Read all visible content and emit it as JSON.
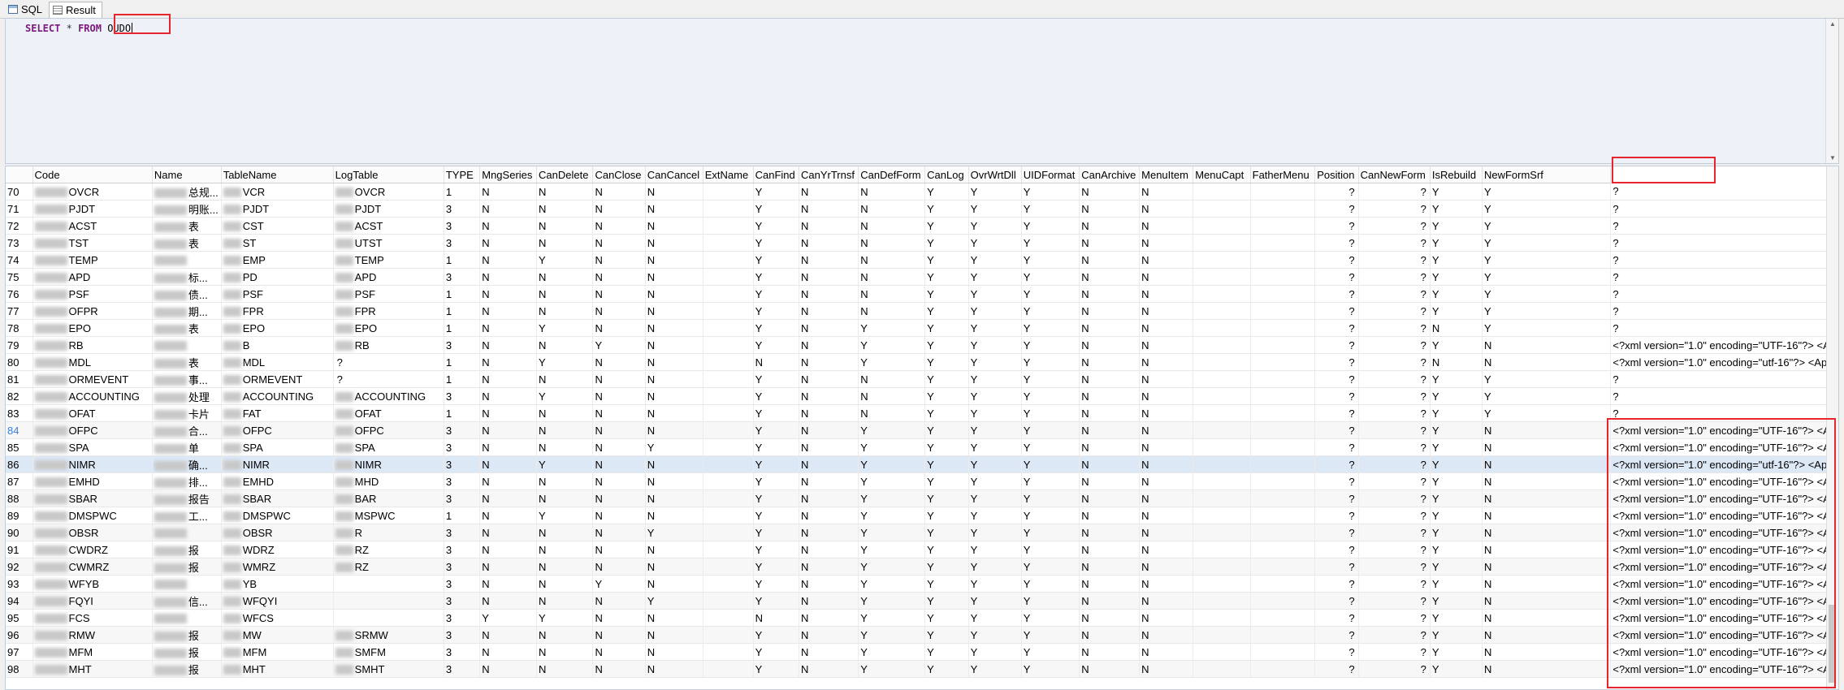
{
  "tabs": [
    {
      "label": "SQL"
    },
    {
      "label": "Result"
    }
  ],
  "query": {
    "select": "SELECT",
    "star": "*",
    "from": "FROM",
    "table": "OUDO"
  },
  "columns": [
    "Code",
    "Name",
    "TableName",
    "LogTable",
    "TYPE",
    "MngSeries",
    "CanDelete",
    "CanClose",
    "CanCancel",
    "ExtName",
    "CanFind",
    "CanYrTrnsf",
    "CanDefForm",
    "CanLog",
    "OvrWrtDll",
    "UIDFormat",
    "CanArchive",
    "MenuItem",
    "MenuCapt",
    "FatherMenu",
    "Position",
    "CanNewForm",
    "IsRebuild",
    "NewFormSrf"
  ],
  "rows": [
    {
      "n": "70",
      "code": "OVCR",
      "name": "总规...",
      "table": "VCR",
      "log": "OVCR",
      "type": "1",
      "v": [
        "N",
        "N",
        "N",
        "N",
        "",
        "Y",
        "N",
        "N",
        "Y",
        "Y",
        "Y",
        "N",
        "N",
        "",
        "",
        "?",
        "?",
        "Y",
        "Y"
      ],
      "srf": "?"
    },
    {
      "n": "71",
      "code": "PJDT",
      "name": "明账...",
      "table": "PJDT",
      "log": "PJDT",
      "type": "3",
      "v": [
        "N",
        "N",
        "N",
        "N",
        "",
        "Y",
        "N",
        "N",
        "Y",
        "Y",
        "Y",
        "N",
        "N",
        "",
        "",
        "?",
        "?",
        "Y",
        "Y"
      ],
      "srf": "?"
    },
    {
      "n": "72",
      "code": "ACST",
      "name": "表",
      "table": "CST",
      "log": "ACST",
      "type": "3",
      "v": [
        "N",
        "N",
        "N",
        "N",
        "",
        "Y",
        "N",
        "N",
        "Y",
        "Y",
        "Y",
        "N",
        "N",
        "",
        "",
        "?",
        "?",
        "Y",
        "Y"
      ],
      "srf": "?"
    },
    {
      "n": "73",
      "code": "TST",
      "name": "表",
      "table": "ST",
      "log": "UTST",
      "type": "3",
      "v": [
        "N",
        "N",
        "N",
        "N",
        "",
        "Y",
        "N",
        "N",
        "Y",
        "Y",
        "Y",
        "N",
        "N",
        "",
        "",
        "?",
        "?",
        "Y",
        "Y"
      ],
      "srf": "?"
    },
    {
      "n": "74",
      "code": "TEMP",
      "name": "",
      "table": "EMP",
      "log": "TEMP",
      "type": "1",
      "v": [
        "N",
        "Y",
        "N",
        "N",
        "",
        "Y",
        "N",
        "N",
        "Y",
        "Y",
        "Y",
        "N",
        "N",
        "",
        "",
        "?",
        "?",
        "Y",
        "Y"
      ],
      "srf": "?"
    },
    {
      "n": "75",
      "code": "APD",
      "name": "标...",
      "table": "PD",
      "log": "APD",
      "type": "3",
      "v": [
        "N",
        "N",
        "N",
        "N",
        "",
        "Y",
        "N",
        "N",
        "Y",
        "Y",
        "Y",
        "N",
        "N",
        "",
        "",
        "?",
        "?",
        "Y",
        "Y"
      ],
      "srf": "?"
    },
    {
      "n": "76",
      "code": "PSF",
      "name": "债...",
      "table": "PSF",
      "log": "PSF",
      "type": "1",
      "v": [
        "N",
        "N",
        "N",
        "N",
        "",
        "Y",
        "N",
        "N",
        "Y",
        "Y",
        "Y",
        "N",
        "N",
        "",
        "",
        "?",
        "?",
        "Y",
        "Y"
      ],
      "srf": "?"
    },
    {
      "n": "77",
      "code": "OFPR",
      "name": "期...",
      "table": "FPR",
      "log": "FPR",
      "type": "1",
      "v": [
        "N",
        "N",
        "N",
        "N",
        "",
        "Y",
        "N",
        "N",
        "Y",
        "Y",
        "Y",
        "N",
        "N",
        "",
        "",
        "?",
        "?",
        "Y",
        "Y"
      ],
      "srf": "?"
    },
    {
      "n": "78",
      "code": "EPO",
      "name": "表",
      "table": "EPO",
      "log": "EPO",
      "type": "1",
      "v": [
        "N",
        "Y",
        "N",
        "N",
        "",
        "Y",
        "N",
        "Y",
        "Y",
        "Y",
        "Y",
        "N",
        "N",
        "",
        "",
        "?",
        "?",
        "N",
        "Y"
      ],
      "srf": "?"
    },
    {
      "n": "79",
      "code": "RB",
      "name": "",
      "table": "B",
      "log": "RB",
      "type": "3",
      "v": [
        "N",
        "N",
        "Y",
        "N",
        "",
        "Y",
        "N",
        "Y",
        "Y",
        "Y",
        "Y",
        "N",
        "N",
        "",
        "",
        "?",
        "?",
        "Y",
        "N"
      ],
      "srf": "<?xml version=\"1.0\" encoding=\"UTF-16\"?> <Ap"
    },
    {
      "n": "80",
      "code": "MDL",
      "name": "表",
      "table": "MDL",
      "log": "?",
      "type": "1",
      "v": [
        "N",
        "Y",
        "N",
        "N",
        "",
        "N",
        "N",
        "Y",
        "Y",
        "Y",
        "Y",
        "N",
        "N",
        "",
        "",
        "?",
        "?",
        "N",
        "N"
      ],
      "srf": "<?xml version=\"1.0\" encoding=\"utf-16\"?> <Ap"
    },
    {
      "n": "81",
      "code": "ORMEVENT",
      "name": "事...",
      "table": "ORMEVENT",
      "log": "?",
      "type": "1",
      "v": [
        "N",
        "N",
        "N",
        "N",
        "",
        "Y",
        "N",
        "N",
        "Y",
        "Y",
        "Y",
        "N",
        "N",
        "",
        "",
        "?",
        "?",
        "Y",
        "Y"
      ],
      "srf": "?"
    },
    {
      "n": "82",
      "code": "ACCOUNTING",
      "name": "处理",
      "table": "ACCOUNTING",
      "log": "ACCOUNTING",
      "type": "3",
      "v": [
        "N",
        "Y",
        "N",
        "N",
        "",
        "Y",
        "N",
        "N",
        "Y",
        "Y",
        "Y",
        "N",
        "N",
        "",
        "",
        "?",
        "?",
        "Y",
        "Y"
      ],
      "srf": "?"
    },
    {
      "n": "83",
      "code": "OFAT",
      "name": "卡片",
      "table": "FAT",
      "log": "OFAT",
      "type": "1",
      "v": [
        "N",
        "N",
        "N",
        "N",
        "",
        "Y",
        "N",
        "N",
        "Y",
        "Y",
        "Y",
        "N",
        "N",
        "",
        "",
        "?",
        "?",
        "Y",
        "Y"
      ],
      "srf": "?"
    },
    {
      "n": "84",
      "code": "OFPC",
      "name": "合...",
      "table": "OFPC",
      "log": "OFPC",
      "type": "3",
      "v": [
        "N",
        "N",
        "N",
        "N",
        "",
        "Y",
        "N",
        "Y",
        "Y",
        "Y",
        "Y",
        "N",
        "N",
        "",
        "",
        "?",
        "?",
        "Y",
        "N"
      ],
      "srf": "<?xml version=\"1.0\" encoding=\"UTF-16\"?> <A"
    },
    {
      "n": "85",
      "code": "SPA",
      "name": "单",
      "table": "SPA",
      "log": "SPA",
      "type": "3",
      "v": [
        "N",
        "N",
        "N",
        "Y",
        "",
        "Y",
        "N",
        "Y",
        "Y",
        "Y",
        "Y",
        "N",
        "N",
        "",
        "",
        "?",
        "?",
        "Y",
        "N"
      ],
      "srf": "<?xml version=\"1.0\" encoding=\"UTF-16\"?> <A"
    },
    {
      "n": "86",
      "code": "NIMR",
      "name": "确...",
      "table": "NIMR",
      "log": "NIMR",
      "type": "3",
      "v": [
        "N",
        "Y",
        "N",
        "N",
        "",
        "Y",
        "N",
        "Y",
        "Y",
        "Y",
        "Y",
        "N",
        "N",
        "",
        "",
        "?",
        "?",
        "Y",
        "N"
      ],
      "srf": "<?xml version=\"1.0\" encoding=\"utf-16\"?> <Ap"
    },
    {
      "n": "87",
      "code": "EMHD",
      "name": "排...",
      "table": "EMHD",
      "log": "MHD",
      "type": "3",
      "v": [
        "N",
        "N",
        "N",
        "N",
        "",
        "Y",
        "N",
        "Y",
        "Y",
        "Y",
        "Y",
        "N",
        "N",
        "",
        "",
        "?",
        "?",
        "Y",
        "N"
      ],
      "srf": "<?xml version=\"1.0\" encoding=\"UTF-16\"?> <A"
    },
    {
      "n": "88",
      "code": "SBAR",
      "name": "报告",
      "table": "SBAR",
      "log": "BAR",
      "type": "3",
      "v": [
        "N",
        "N",
        "N",
        "N",
        "",
        "Y",
        "N",
        "Y",
        "Y",
        "Y",
        "Y",
        "N",
        "N",
        "",
        "",
        "?",
        "?",
        "Y",
        "N"
      ],
      "srf": "<?xml version=\"1.0\" encoding=\"UTF-16\"?> <A"
    },
    {
      "n": "89",
      "code": "DMSPWC",
      "name": "工...",
      "table": "DMSPWC",
      "log": "MSPWC",
      "type": "1",
      "v": [
        "N",
        "Y",
        "N",
        "N",
        "",
        "Y",
        "N",
        "Y",
        "Y",
        "Y",
        "Y",
        "N",
        "N",
        "",
        "",
        "?",
        "?",
        "Y",
        "N"
      ],
      "srf": "<?xml version=\"1.0\" encoding=\"UTF-16\"?> <A"
    },
    {
      "n": "90",
      "code": "OBSR",
      "name": "",
      "table": "OBSR",
      "log": "R",
      "type": "3",
      "v": [
        "N",
        "N",
        "N",
        "Y",
        "",
        "Y",
        "N",
        "Y",
        "Y",
        "Y",
        "Y",
        "N",
        "N",
        "",
        "",
        "?",
        "?",
        "Y",
        "N"
      ],
      "srf": "<?xml version=\"1.0\" encoding=\"UTF-16\"?> <A"
    },
    {
      "n": "91",
      "code": "CWDRZ",
      "name": "报",
      "table": "WDRZ",
      "log": "RZ",
      "type": "3",
      "v": [
        "N",
        "N",
        "N",
        "N",
        "",
        "Y",
        "N",
        "Y",
        "Y",
        "Y",
        "Y",
        "N",
        "N",
        "",
        "",
        "?",
        "?",
        "Y",
        "N"
      ],
      "srf": "<?xml version=\"1.0\" encoding=\"UTF-16\"?> <A"
    },
    {
      "n": "92",
      "code": "CWMRZ",
      "name": "报",
      "table": "WMRZ",
      "log": "RZ",
      "type": "3",
      "v": [
        "N",
        "N",
        "N",
        "N",
        "",
        "Y",
        "N",
        "Y",
        "Y",
        "Y",
        "Y",
        "N",
        "N",
        "",
        "",
        "?",
        "?",
        "Y",
        "N"
      ],
      "srf": "<?xml version=\"1.0\" encoding=\"UTF-16\"?> <A"
    },
    {
      "n": "93",
      "code": "WFYB",
      "name": "",
      "table": "YB",
      "log": "",
      "type": "3",
      "v": [
        "N",
        "N",
        "Y",
        "N",
        "",
        "Y",
        "N",
        "Y",
        "Y",
        "Y",
        "Y",
        "N",
        "N",
        "",
        "",
        "?",
        "?",
        "Y",
        "N"
      ],
      "srf": "<?xml version=\"1.0\" encoding=\"UTF-16\"?> <A"
    },
    {
      "n": "94",
      "code": "FQYI",
      "name": "信...",
      "table": "WFQYI",
      "log": "",
      "type": "3",
      "v": [
        "N",
        "N",
        "N",
        "Y",
        "",
        "Y",
        "N",
        "Y",
        "Y",
        "Y",
        "Y",
        "N",
        "N",
        "",
        "",
        "?",
        "?",
        "Y",
        "N"
      ],
      "srf": "<?xml version=\"1.0\" encoding=\"UTF-16\"?> <A"
    },
    {
      "n": "95",
      "code": "FCS",
      "name": "",
      "table": "WFCS",
      "log": "",
      "type": "3",
      "v": [
        "Y",
        "Y",
        "N",
        "N",
        "",
        "N",
        "N",
        "Y",
        "Y",
        "Y",
        "Y",
        "N",
        "N",
        "",
        "",
        "?",
        "?",
        "Y",
        "N"
      ],
      "srf": "<?xml version=\"1.0\" encoding=\"UTF-16\"?> <A"
    },
    {
      "n": "96",
      "code": "RMW",
      "name": "报",
      "table": "MW",
      "log": "SRMW",
      "type": "3",
      "v": [
        "N",
        "N",
        "N",
        "N",
        "",
        "Y",
        "N",
        "Y",
        "Y",
        "Y",
        "Y",
        "N",
        "N",
        "",
        "",
        "?",
        "?",
        "Y",
        "N"
      ],
      "srf": "<?xml version=\"1.0\" encoding=\"UTF-16\"?> <A"
    },
    {
      "n": "97",
      "code": "MFM",
      "name": "报",
      "table": "MFM",
      "log": "SMFM",
      "type": "3",
      "v": [
        "N",
        "N",
        "N",
        "N",
        "",
        "Y",
        "N",
        "Y",
        "Y",
        "Y",
        "Y",
        "N",
        "N",
        "",
        "",
        "?",
        "?",
        "Y",
        "N"
      ],
      "srf": "<?xml version=\"1.0\" encoding=\"UTF-16\"?> <A"
    },
    {
      "n": "98",
      "code": "MHT",
      "name": "报",
      "table": "MHT",
      "log": "SMHT",
      "type": "3",
      "v": [
        "N",
        "N",
        "N",
        "N",
        "",
        "Y",
        "N",
        "Y",
        "Y",
        "Y",
        "Y",
        "N",
        "N",
        "",
        "",
        "?",
        "?",
        "Y",
        "N"
      ],
      "srf": "<?xml version=\"1.0\" encoding=\"UTF-16\"?> <A"
    }
  ],
  "selected_row": "86",
  "highlight_color": "#e8242c"
}
